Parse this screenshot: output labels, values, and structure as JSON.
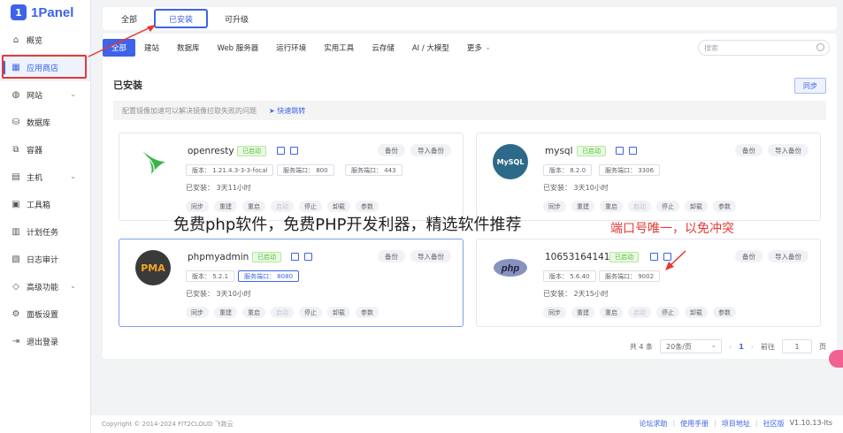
{
  "brand": {
    "name": "1Panel"
  },
  "sidebar": {
    "items": [
      {
        "label": "概览",
        "icon": "home-icon"
      },
      {
        "label": "应用商店",
        "icon": "grid-icon",
        "active": true
      },
      {
        "label": "网站",
        "icon": "globe-icon",
        "has_children": true
      },
      {
        "label": "数据库",
        "icon": "database-icon"
      },
      {
        "label": "容器",
        "icon": "container-icon"
      },
      {
        "label": "主机",
        "icon": "server-icon",
        "has_children": true
      },
      {
        "label": "工具箱",
        "icon": "toolbox-icon"
      },
      {
        "label": "计划任务",
        "icon": "calendar-icon"
      },
      {
        "label": "日志审计",
        "icon": "log-icon"
      },
      {
        "label": "高级功能",
        "icon": "diamond-icon",
        "has_children": true
      },
      {
        "label": "面板设置",
        "icon": "gear-icon"
      },
      {
        "label": "退出登录",
        "icon": "logout-icon"
      }
    ]
  },
  "top_tabs": [
    {
      "label": "全部"
    },
    {
      "label": "已安装",
      "active": true
    },
    {
      "label": "可升级"
    }
  ],
  "categories": [
    {
      "label": "全部",
      "active": true
    },
    {
      "label": "建站"
    },
    {
      "label": "数据库"
    },
    {
      "label": "Web 服务器"
    },
    {
      "label": "运行环境"
    },
    {
      "label": "实用工具"
    },
    {
      "label": "云存储"
    },
    {
      "label": "AI / 大模型"
    },
    {
      "label": "更多"
    }
  ],
  "search": {
    "placeholder": "搜索"
  },
  "section": {
    "title": "已安装",
    "sync_label": "同步"
  },
  "tip": {
    "text": "配置镜像加速可以解决镜像拉取失败的问题",
    "link": "快速跳转"
  },
  "apps": [
    {
      "name": "openresty",
      "status": "已启动",
      "version": "版本： 1.21.4.3-3-3-focal",
      "port": "服务端口： 800",
      "https_port": "服务端口： 443",
      "installed": "已安装： 3天11小时",
      "backup": "备份",
      "import": "导入备份",
      "actions": [
        "同步",
        "重建",
        "重启",
        "启动",
        "停止",
        "卸载",
        "参数"
      ]
    },
    {
      "name": "mysql",
      "status": "已启动",
      "version": "版本： 8.2.0",
      "port": "服务端口： 3306",
      "installed": "已安装： 3天10小时",
      "backup": "备份",
      "import": "导入备份",
      "actions": [
        "同步",
        "重建",
        "重启",
        "启动",
        "停止",
        "卸载",
        "参数"
      ]
    },
    {
      "name": "phpmyadmin",
      "status": "已启动",
      "version": "版本： 5.2.1",
      "port": "服务端口： 8080",
      "installed": "已安装： 3天10小时",
      "backup": "备份",
      "import": "导入备份",
      "actions": [
        "同步",
        "重建",
        "重启",
        "启动",
        "停止",
        "卸载",
        "参数"
      ]
    },
    {
      "name": "10653164141",
      "status": "已启动",
      "version": "版本： 5.6.40",
      "port": "服务端口： 9002",
      "installed": "已安装： 2天15小时",
      "backup": "备份",
      "import": "导入备份",
      "actions": [
        "同步",
        "重建",
        "重启",
        "启动",
        "停止",
        "卸载",
        "参数"
      ]
    }
  ],
  "pager": {
    "total": "共 4 条",
    "page_size": "20条/页",
    "current": "1",
    "goto": "前往",
    "goto_value": "1",
    "page_unit": "页"
  },
  "overlay": {
    "caption": "免费php软件，免费PHP开发利器，精选软件推荐",
    "annotation": "端口号唯一，以免冲突"
  },
  "footer": {
    "copyright": "Copyright © 2014-2024 FIT2CLOUD 飞致云",
    "links": [
      "论坛求助",
      "使用手册",
      "项目地址",
      "社区版"
    ],
    "version": "V1.10.13-lts"
  },
  "colors": {
    "accent": "#3d63e8",
    "running": "#52c41a",
    "annotation": "#e53935"
  }
}
